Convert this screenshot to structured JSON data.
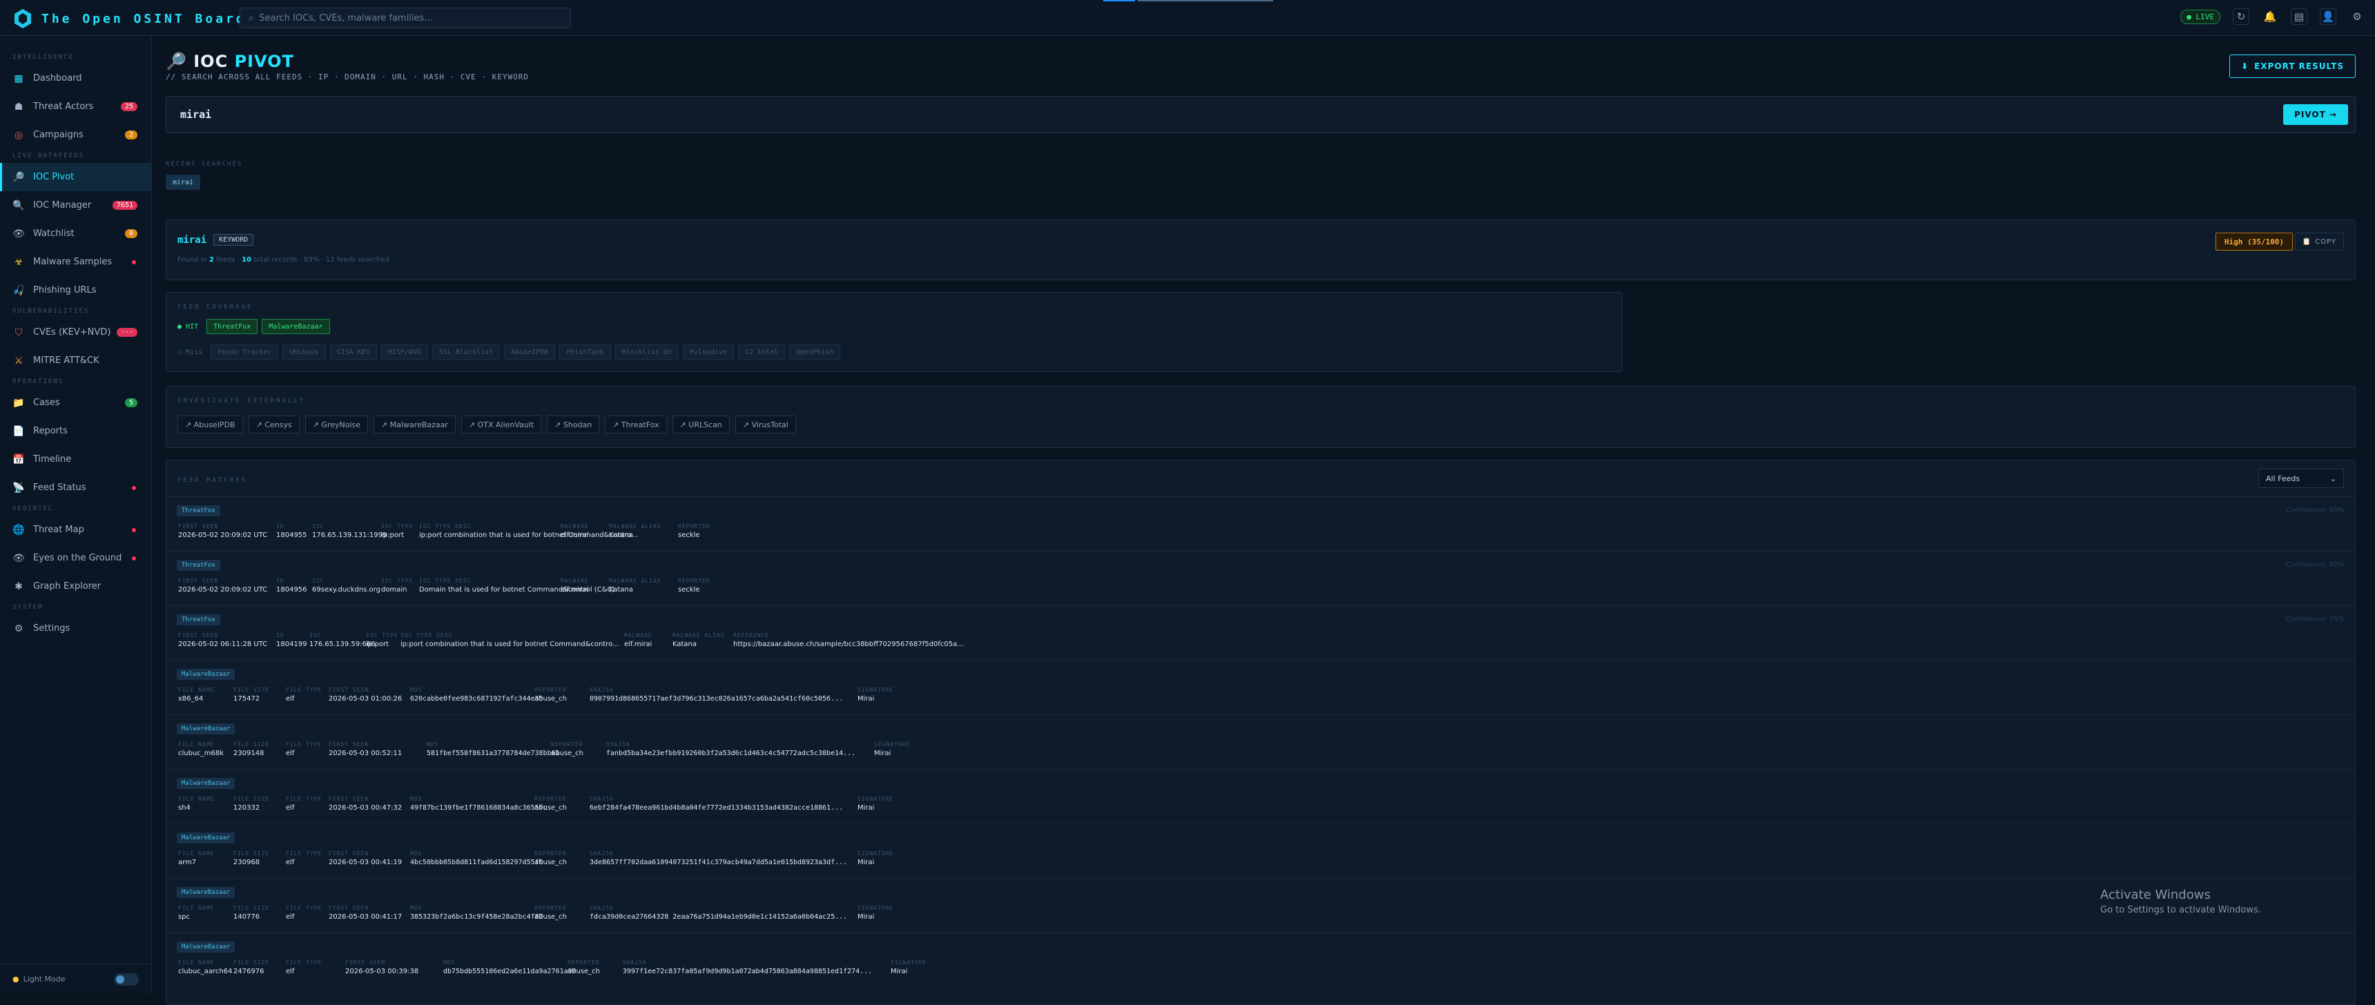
{
  "app": {
    "title": "The Open OSINT Board"
  },
  "search": {
    "placeholder": "Search IOCs, CVEs, malware families..."
  },
  "topbar": {
    "live": "● LIVE"
  },
  "sidebar": {
    "sections": {
      "intelligence": "Intelligence",
      "live_datafeeds": "Live Datafeeds",
      "vulnerabilities": "Vulnerabilities",
      "operations": "Operations",
      "geointel": "Geointel",
      "system": "System"
    },
    "items": {
      "dashboard": "Dashboard",
      "threat_actors": "Threat Actors",
      "threat_actors_badge": "25",
      "campaigns": "Campaigns",
      "campaigns_badge": "2",
      "ioc_pivot": "IOC Pivot",
      "ioc_manager": "IOC Manager",
      "ioc_manager_badge": "7651",
      "watchlist": "Watchlist",
      "watchlist_badge": "0",
      "malware_samples": "Malware Samples",
      "phishing_urls": "Phishing URLs",
      "cves": "CVEs (KEV+NVD)",
      "cves_badge": "···",
      "mitre": "MITRE ATT&CK",
      "cases": "Cases",
      "cases_badge": "5",
      "reports": "Reports",
      "timeline": "Timeline",
      "feed_status": "Feed Status",
      "threat_map": "Threat Map",
      "eyes_on_ground": "Eyes on the Ground",
      "graph_explorer": "Graph Explorer",
      "settings": "Settings"
    },
    "footer": {
      "light_mode": "Light Mode"
    }
  },
  "page": {
    "title_prefix": "IOC",
    "title_accent": "PIVOT",
    "subtitle": "// SEARCH ACROSS ALL FEEDS · IP · DOMAIN · URL · HASH · CVE · KEYWORD",
    "export": "EXPORT RESULTS"
  },
  "query": {
    "value": "mirai",
    "pivot_button": "PIVOT →"
  },
  "recent": {
    "label": "RECENT SEARCHES",
    "items": [
      "mirai"
    ]
  },
  "result": {
    "query": "mirai",
    "type": "KEYWORD",
    "meta_prefix": "Found in",
    "feeds_count": "2",
    "feeds_text": "feeds ·",
    "records_count": "10",
    "records_text": "total records · 83% · 12 feeds searched",
    "risk": "High (35/100)",
    "copy": "COPY"
  },
  "coverage": {
    "title": "FEED COVERAGE",
    "hit_label": "● HIT",
    "miss_label": "○ Miss",
    "hits": [
      "ThreatFox",
      "MalwareBazaar"
    ],
    "misses": [
      "Feodo Tracker",
      "URLhaus",
      "CISA KEV",
      "MISP/NVD",
      "SSL Blacklist",
      "AbuseIPDB",
      "PhishTank",
      "Blocklist.de",
      "Pulsedive",
      "C2 Intel",
      "OpenPhish"
    ]
  },
  "external": {
    "title": "INVESTIGATE EXTERNALLY",
    "links": [
      "↗ AbuseIPDB",
      "↗ Censys",
      "↗ GreyNoise",
      "↗ MalwareBazaar",
      "↗ OTX AlienVault",
      "↗ Shodan",
      "↗ ThreatFox",
      "↗ URLScan",
      "↗ VirusTotal"
    ]
  },
  "matches": {
    "title": "FEED MATCHES",
    "filter": "All Feeds",
    "rows": [
      {
        "source": "ThreatFox",
        "conf": "Confidence: 80%",
        "fields": [
          {
            "l": "FIRST SEEN",
            "v": "2026-05-02 20:09:02 UTC"
          },
          {
            "l": "ID",
            "v": "1804955"
          },
          {
            "l": "IOC",
            "v": "176.65.139.131:1999"
          },
          {
            "l": "IOC TYPE",
            "v": "ip:port"
          },
          {
            "l": "IOC TYPE DESC",
            "v": "ip:port combination that is used for botnet Command&contro..."
          },
          {
            "l": "MALWARE",
            "v": "elf.mirai"
          },
          {
            "l": "MALWARE ALIAS",
            "v": "Katana"
          },
          {
            "l": "REPORTER",
            "v": "seckle"
          }
        ]
      },
      {
        "source": "ThreatFox",
        "conf": "Confidence: 80%",
        "fields": [
          {
            "l": "FIRST SEEN",
            "v": "2026-05-02 20:09:02 UTC"
          },
          {
            "l": "ID",
            "v": "1804956"
          },
          {
            "l": "IOC",
            "v": "69sexy.duckdns.org"
          },
          {
            "l": "IOC TYPE",
            "v": "domain"
          },
          {
            "l": "IOC TYPE DESC",
            "v": "Domain that is used for botnet Command&control (C&C)"
          },
          {
            "l": "MALWARE",
            "v": "elf.mirai"
          },
          {
            "l": "MALWARE ALIAS",
            "v": "Katana"
          },
          {
            "l": "REPORTER",
            "v": "seckle"
          }
        ]
      },
      {
        "source": "ThreatFox",
        "conf": "Confidence: 75%",
        "fields": [
          {
            "l": "FIRST SEEN",
            "v": "2026-05-02 06:11:28 UTC"
          },
          {
            "l": "ID",
            "v": "1804199"
          },
          {
            "l": "IOC",
            "v": "176.65.139.59:666"
          },
          {
            "l": "IOC TYPE",
            "v": "ip:port"
          },
          {
            "l": "IOC TYPE DESC",
            "v": "ip:port combination that is used for botnet Command&contro..."
          },
          {
            "l": "MALWARE",
            "v": "elf.mirai"
          },
          {
            "l": "MALWARE ALIAS",
            "v": "Katana"
          },
          {
            "l": "REFERENCE",
            "v": "https://bazaar.abuse.ch/sample/bcc38bbff7029567687f5d0fc05a..."
          }
        ]
      },
      {
        "source": "MalwareBazaar",
        "conf": "",
        "fields": [
          {
            "l": "FILE NAME",
            "v": "x86_64"
          },
          {
            "l": "FILE SIZE",
            "v": "175472"
          },
          {
            "l": "FILE TYPE",
            "v": "elf"
          },
          {
            "l": "FIRST SEEN",
            "v": "2026-05-03 01:00:26"
          },
          {
            "l": "MD5",
            "v": "620cabbe0fee983c687192fafc344e35"
          },
          {
            "l": "REPORTER",
            "v": "abuse_ch"
          },
          {
            "l": "SHA256",
            "v": "0907991d868655717aef3d796c313ec026a1657ca6ba2a541cf60c5056..."
          },
          {
            "l": "SIGNATURE",
            "v": "Mirai"
          }
        ]
      },
      {
        "source": "MalwareBazaar",
        "conf": "",
        "fields": [
          {
            "l": "FILE NAME",
            "v": "clubuc_m68k"
          },
          {
            "l": "FILE SIZE",
            "v": "2309148"
          },
          {
            "l": "FILE TYPE",
            "v": "elf"
          },
          {
            "l": "FIRST SEEN",
            "v": "2026-05-03 00:52:11"
          },
          {
            "l": "MD5",
            "v": "581fbef558f8631a3778784de738bb61"
          },
          {
            "l": "REPORTER",
            "v": "abuse_ch"
          },
          {
            "l": "SHA256",
            "v": "fanbd5ba34e23efbb919260b3f2a53d6c1d463c4c54772adc5c38be14..."
          },
          {
            "l": "SIGNATURE",
            "v": "Mirai"
          }
        ]
      },
      {
        "source": "MalwareBazaar",
        "conf": "",
        "fields": [
          {
            "l": "FILE NAME",
            "v": "sh4"
          },
          {
            "l": "FILE SIZE",
            "v": "120332"
          },
          {
            "l": "FILE TYPE",
            "v": "elf"
          },
          {
            "l": "FIRST SEEN",
            "v": "2026-05-03 00:47:32"
          },
          {
            "l": "MD5",
            "v": "49f87bc139fbe1f786168834a8c3655fc"
          },
          {
            "l": "REPORTER",
            "v": "abuse_ch"
          },
          {
            "l": "SHA256",
            "v": "6ebf284fa478eea961bd4b8a04fe7772ed1334b3153ad4382acce18861..."
          },
          {
            "l": "SIGNATURE",
            "v": "Mirai"
          }
        ]
      },
      {
        "source": "MalwareBazaar",
        "conf": "",
        "fields": [
          {
            "l": "FILE NAME",
            "v": "arm7"
          },
          {
            "l": "FILE SIZE",
            "v": "230968"
          },
          {
            "l": "FILE TYPE",
            "v": "elf"
          },
          {
            "l": "FIRST SEEN",
            "v": "2026-05-03 00:41:19"
          },
          {
            "l": "MD5",
            "v": "4bc50bbb05b8d811fad6d158297d55f6"
          },
          {
            "l": "REPORTER",
            "v": "abuse_ch"
          },
          {
            "l": "SHA256",
            "v": "3de8657ff702daa61094073251f41c379acb49a7dd5a1e015bd8923a3df..."
          },
          {
            "l": "SIGNATURE",
            "v": "Mirai"
          }
        ]
      },
      {
        "source": "MalwareBazaar",
        "conf": "",
        "fields": [
          {
            "l": "FILE NAME",
            "v": "spc"
          },
          {
            "l": "FILE SIZE",
            "v": "140776"
          },
          {
            "l": "FILE TYPE",
            "v": "elf"
          },
          {
            "l": "FIRST SEEN",
            "v": "2026-05-03 00:41:17"
          },
          {
            "l": "MD5",
            "v": "385323bf2a6bc13c9f458e28a2bc4f87"
          },
          {
            "l": "REPORTER",
            "v": "abuse_ch"
          },
          {
            "l": "SHA256",
            "v": "fdca39d0cea27664328 2eaa76a751d94a1eb9d0e1c14152a6a0b04ac25..."
          },
          {
            "l": "SIGNATURE",
            "v": "Mirai"
          }
        ]
      },
      {
        "source": "MalwareBazaar",
        "conf": "",
        "fields": [
          {
            "l": "FILE NAME",
            "v": "clubuc_aarch64"
          },
          {
            "l": "FILE SIZE",
            "v": "2476976"
          },
          {
            "l": "FILE TYPE",
            "v": "elf"
          },
          {
            "l": "FIRST SEEN",
            "v": "2026-05-03 00:39:38"
          },
          {
            "l": "MD5",
            "v": "db75bdb555106ed2a6e11da9a2761a99"
          },
          {
            "l": "REPORTER",
            "v": "abuse_ch"
          },
          {
            "l": "SHA256",
            "v": "3997f1ee72c837fa05af9d9d9b1a072ab4d75863a884a98851ed1f274..."
          },
          {
            "l": "SIGNATURE",
            "v": "Mirai"
          }
        ]
      }
    ]
  },
  "watermark": {
    "line1": "Activate Windows",
    "line2": "Go to Settings to activate Windows."
  },
  "colors": {
    "accent": "#22e3ff",
    "background": "#0a1320",
    "hit": "#37e083",
    "danger": "#ff3355",
    "warning": "#ffaa33"
  }
}
